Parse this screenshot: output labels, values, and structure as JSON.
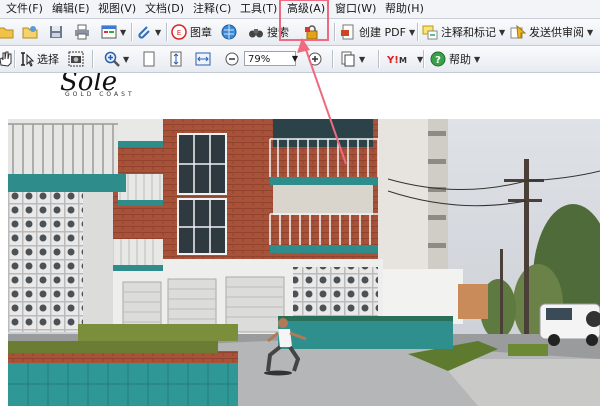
{
  "menu": {
    "items": [
      {
        "label": "文件(F)"
      },
      {
        "label": "编辑(E)"
      },
      {
        "label": "视图(V)"
      },
      {
        "label": "文档(D)"
      },
      {
        "label": "注释(C)"
      },
      {
        "label": "工具(T)"
      },
      {
        "label": "高级(A)"
      },
      {
        "label": "窗口(W)"
      },
      {
        "label": "帮助(H)"
      }
    ]
  },
  "toolbar1": {
    "stamp_label": "图章",
    "search_label": "搜索",
    "create_pdf_label": "创建 PDF",
    "comment_label": "注释和标记",
    "review_label": "发送供审阅"
  },
  "toolbar2": {
    "select_label": "选择",
    "zoom_value": "79%",
    "help_label": "帮助"
  },
  "document": {
    "logo_text": "Sole",
    "tagline": "GOLD COAST"
  },
  "colors": {
    "highlight": "#ef6a80",
    "accent": "#1e62c4"
  }
}
